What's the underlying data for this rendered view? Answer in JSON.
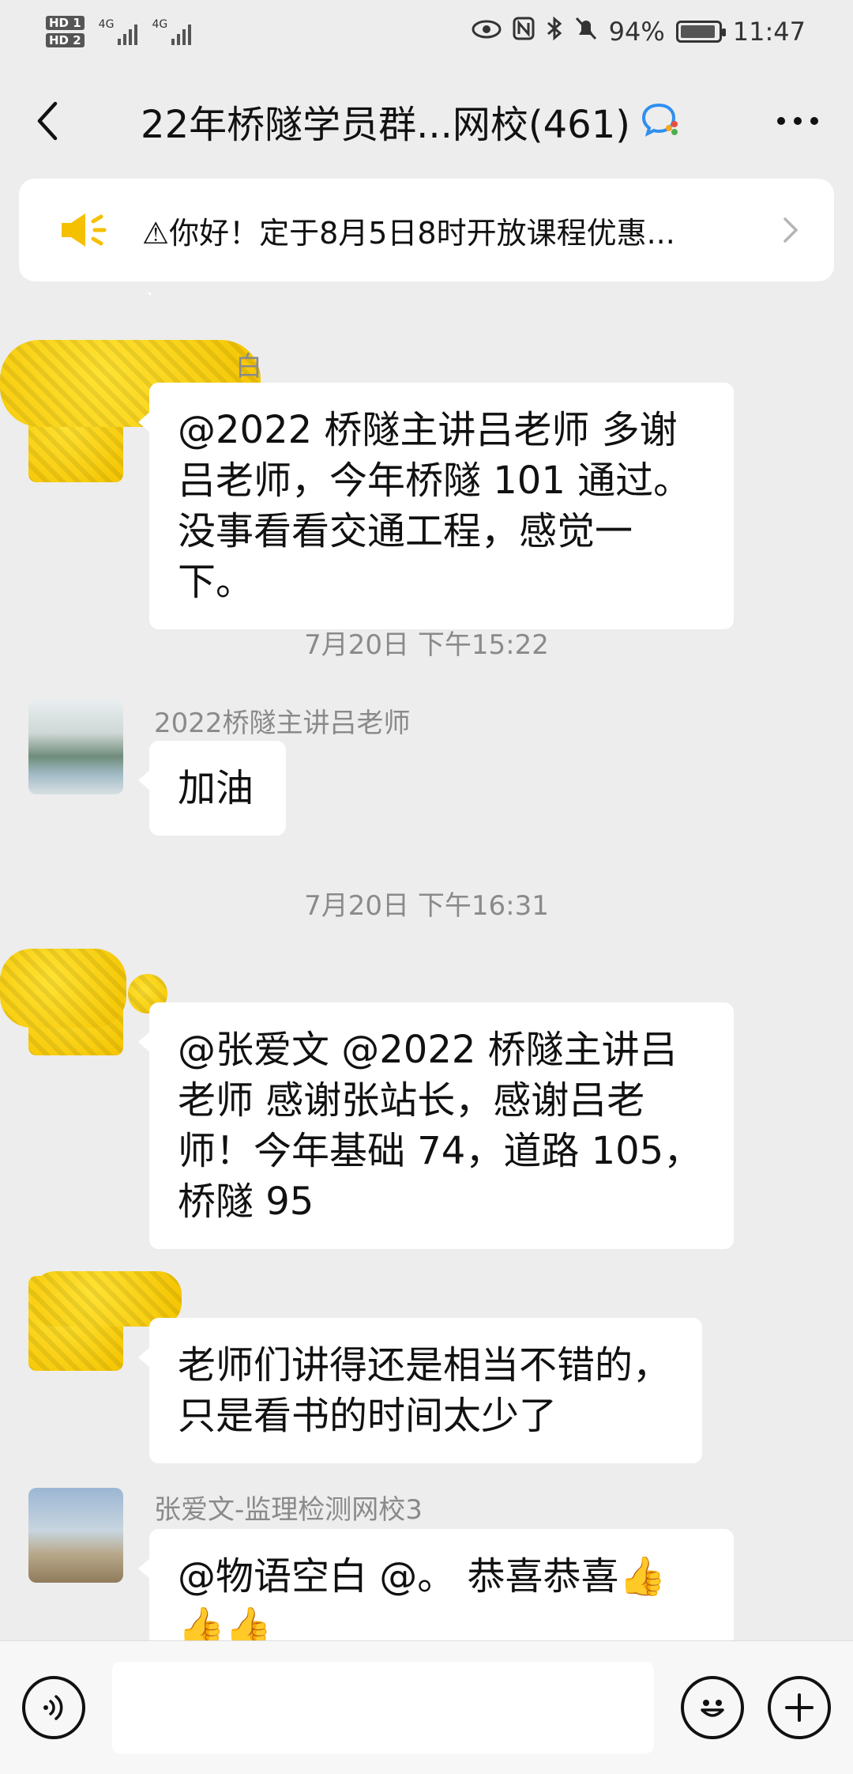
{
  "status_bar": {
    "hd1": "HD 1",
    "hd2": "HD 2",
    "sig1_label": "4G",
    "sig2_label": "4G",
    "battery": "94%",
    "battery_level": 0.94,
    "time": "11:47"
  },
  "header": {
    "title": "22年桥隧学员群...网校(461)"
  },
  "announcement": {
    "text": "⚠你好！定于8月5日8时开放课程优惠..."
  },
  "messages": {
    "m1": {
      "sender_partial": "白",
      "text": "@2022 桥隧主讲吕老师  多谢吕老师，今年桥隧 101 通过。没事看看交通工程，感觉一下。"
    },
    "time1": "7月20日 下午15:22",
    "m2": {
      "sender": "2022桥隧主讲吕老师",
      "text": "加油"
    },
    "time2": "7月20日 下午16:31",
    "m3": {
      "text": "@张爱文  @2022 桥隧主讲吕老师  感谢张站长，感谢吕老师！今年基础 74，道路 105，桥隧 95"
    },
    "m4": {
      "text": "老师们讲得还是相当不错的，只是看书的时间太少了"
    },
    "m5": {
      "sender": "张爱文-监理检测网校3",
      "text": "@物语空白  @。 恭喜恭喜👍👍👍"
    }
  },
  "colors": {
    "background": "#ededed",
    "bubble": "#ffffff",
    "accent_blue": "#2f8ff0",
    "speaker_yellow": "#f5c000"
  }
}
